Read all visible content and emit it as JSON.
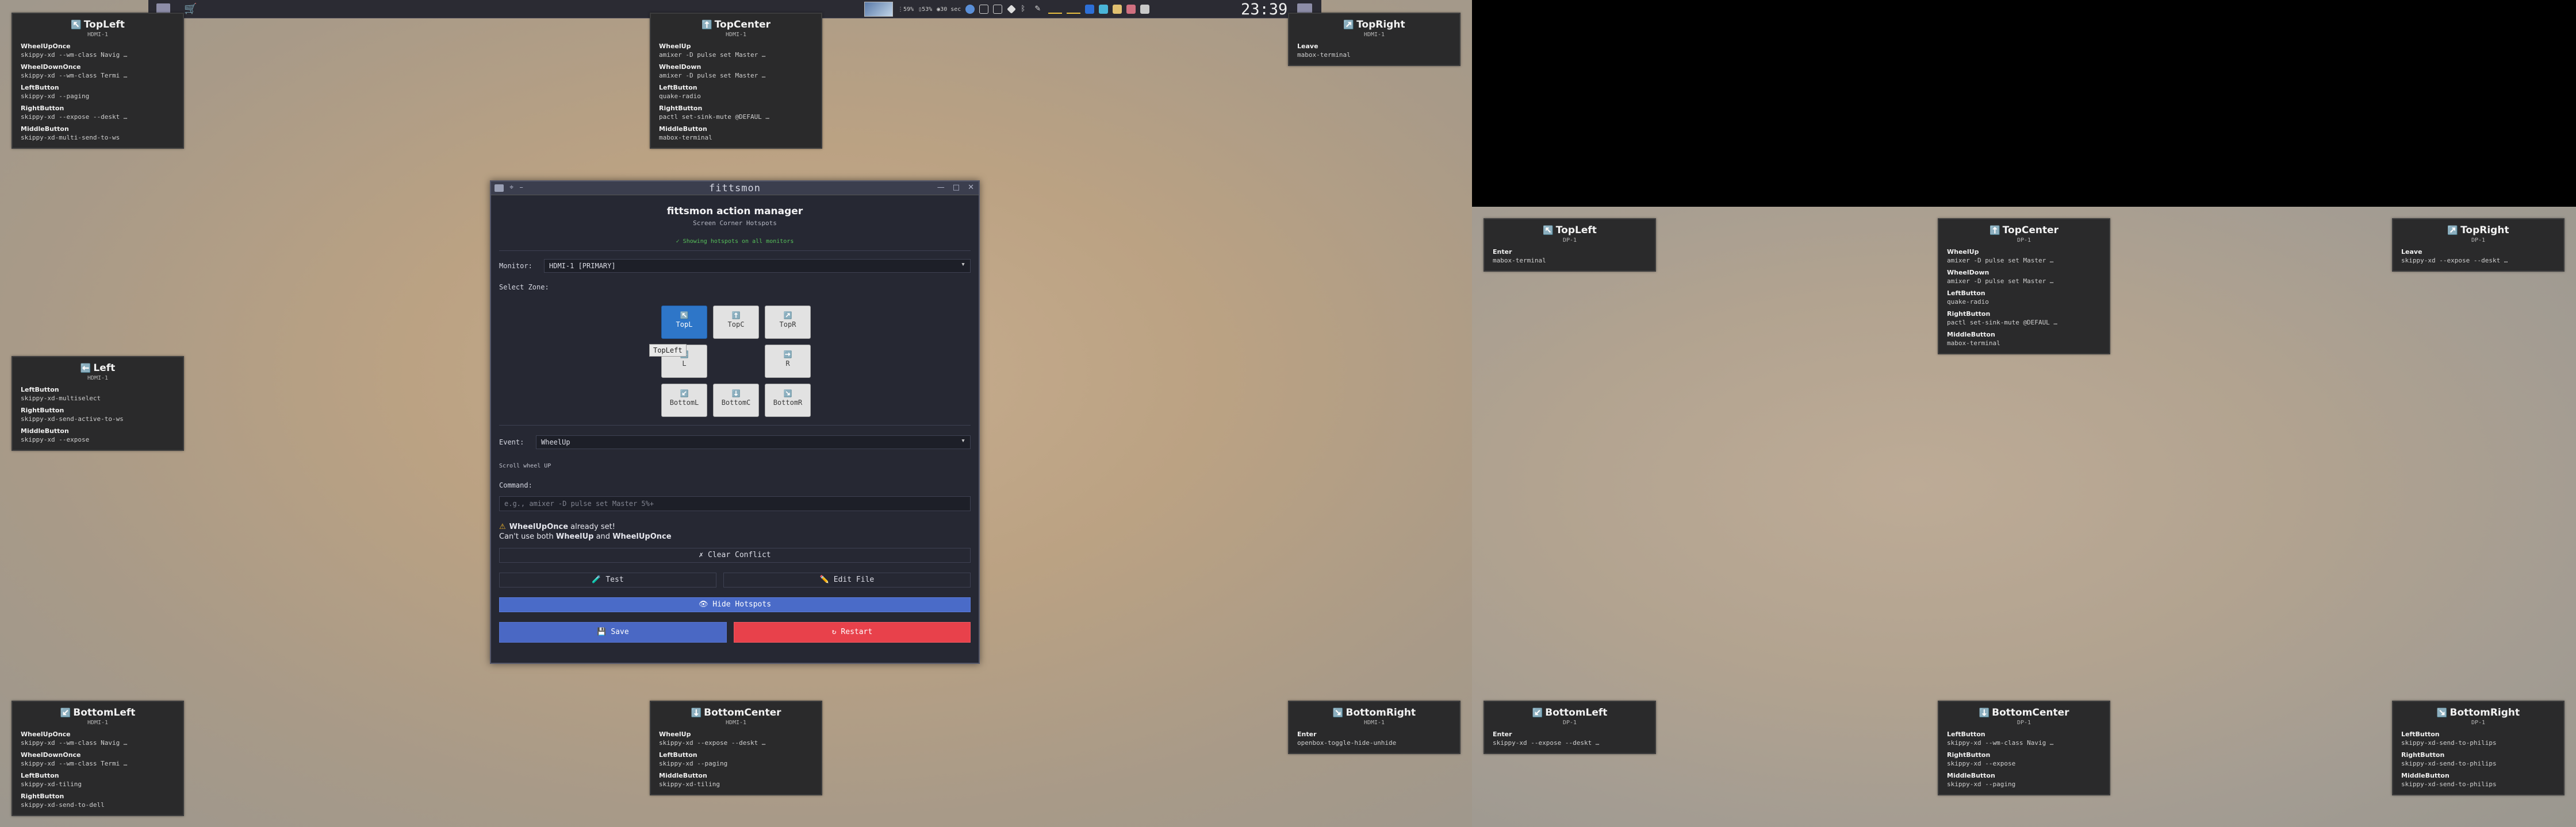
{
  "topbar": {
    "tray_text_1": "59%",
    "tray_text_2": "53%",
    "tray_text_3": "30 sec",
    "clock": "23:39"
  },
  "cards": {
    "hdmi_topleft": {
      "icon": "↖️",
      "title": "TopLeft",
      "monitor": "HDMI-1",
      "entries": [
        {
          "event": "WheelUpOnce",
          "cmd": "skippy-xd --wm-class Navig …"
        },
        {
          "event": "WheelDownOnce",
          "cmd": "skippy-xd --wm-class Termi …"
        },
        {
          "event": "LeftButton",
          "cmd": "skippy-xd --paging"
        },
        {
          "event": "RightButton",
          "cmd": "skippy-xd --expose --deskt …"
        },
        {
          "event": "MiddleButton",
          "cmd": "skippy-xd-multi-send-to-ws"
        }
      ]
    },
    "hdmi_topcenter": {
      "icon": "⬆️",
      "title": "TopCenter",
      "monitor": "HDMI-1",
      "entries": [
        {
          "event": "WheelUp",
          "cmd": "amixer -D pulse set Master …"
        },
        {
          "event": "WheelDown",
          "cmd": "amixer -D pulse set Master …"
        },
        {
          "event": "LeftButton",
          "cmd": "quake-radio"
        },
        {
          "event": "RightButton",
          "cmd": "pactl set-sink-mute @DEFAUL …"
        },
        {
          "event": "MiddleButton",
          "cmd": "mabox-terminal"
        }
      ]
    },
    "hdmi_topright": {
      "icon": "↗️",
      "title": "TopRight",
      "monitor": "HDMI-1",
      "entries": [
        {
          "event": "Leave",
          "cmd": "mabox-terminal"
        }
      ]
    },
    "hdmi_left": {
      "icon": "⬅️",
      "title": "Left",
      "monitor": "HDMI-1",
      "entries": [
        {
          "event": "LeftButton",
          "cmd": "skippy-xd-multiselect"
        },
        {
          "event": "RightButton",
          "cmd": "skippy-xd-send-active-to-ws"
        },
        {
          "event": "MiddleButton",
          "cmd": "skippy-xd --expose"
        }
      ]
    },
    "hdmi_bottomleft": {
      "icon": "↙️",
      "title": "BottomLeft",
      "monitor": "HDMI-1",
      "entries": [
        {
          "event": "WheelUpOnce",
          "cmd": "skippy-xd --wm-class Navig …"
        },
        {
          "event": "WheelDownOnce",
          "cmd": "skippy-xd --wm-class Termi …"
        },
        {
          "event": "LeftButton",
          "cmd": "skippy-xd-tiling"
        },
        {
          "event": "RightButton",
          "cmd": "skippy-xd-send-to-dell"
        }
      ]
    },
    "hdmi_bottomcenter": {
      "icon": "⬇️",
      "title": "BottomCenter",
      "monitor": "HDMI-1",
      "entries": [
        {
          "event": "WheelUp",
          "cmd": "skippy-xd --expose --deskt …"
        },
        {
          "event": "LeftButton",
          "cmd": "skippy-xd --paging"
        },
        {
          "event": "MiddleButton",
          "cmd": "skippy-xd-tiling"
        }
      ]
    },
    "hdmi_bottomright": {
      "icon": "↘️",
      "title": "BottomRight",
      "monitor": "HDMI-1",
      "entries": [
        {
          "event": "Enter",
          "cmd": "openbox-toggle-hide-unhide"
        }
      ]
    },
    "dp_topleft": {
      "icon": "↖️",
      "title": "TopLeft",
      "monitor": "DP-1",
      "entries": [
        {
          "event": "Enter",
          "cmd": "mabox-terminal"
        }
      ]
    },
    "dp_topcenter": {
      "icon": "⬆️",
      "title": "TopCenter",
      "monitor": "DP-1",
      "entries": [
        {
          "event": "WheelUp",
          "cmd": "amixer -D pulse set Master …"
        },
        {
          "event": "WheelDown",
          "cmd": "amixer -D pulse set Master …"
        },
        {
          "event": "LeftButton",
          "cmd": "quake-radio"
        },
        {
          "event": "RightButton",
          "cmd": "pactl set-sink-mute @DEFAUL …"
        },
        {
          "event": "MiddleButton",
          "cmd": "mabox-terminal"
        }
      ]
    },
    "dp_topright": {
      "icon": "↗️",
      "title": "TopRight",
      "monitor": "DP-1",
      "entries": [
        {
          "event": "Leave",
          "cmd": "skippy-xd --expose --deskt …"
        }
      ]
    },
    "dp_bottomleft": {
      "icon": "↙️",
      "title": "BottomLeft",
      "monitor": "DP-1",
      "entries": [
        {
          "event": "Enter",
          "cmd": "skippy-xd --expose --deskt …"
        }
      ]
    },
    "dp_bottomcenter": {
      "icon": "⬇️",
      "title": "BottomCenter",
      "monitor": "DP-1",
      "entries": [
        {
          "event": "LeftButton",
          "cmd": "skippy-xd --wm-class Navig …"
        },
        {
          "event": "RightButton",
          "cmd": "skippy-xd --expose"
        },
        {
          "event": "MiddleButton",
          "cmd": "skippy-xd --paging"
        }
      ]
    },
    "dp_bottomright": {
      "icon": "↘️",
      "title": "BottomRight",
      "monitor": "DP-1",
      "entries": [
        {
          "event": "LeftButton",
          "cmd": "skippy-xd-send-to-philips"
        },
        {
          "event": "RightButton",
          "cmd": "skippy-xd-send-to-philips"
        },
        {
          "event": "MiddleButton",
          "cmd": "skippy-xd-send-to-philips"
        }
      ]
    }
  },
  "dialog": {
    "window_title": "fittsmon",
    "app_title": "fittsmon action manager",
    "app_subtitle": "Screen Corner Hotspots",
    "status": "✓ Showing hotspots on all monitors",
    "monitor_label": "Monitor:",
    "monitor_value": "HDMI-1 [PRIMARY]",
    "zone_label": "Select Zone:",
    "zones": {
      "topl": {
        "icon": "↖️",
        "label": "TopL"
      },
      "topc": {
        "icon": "⬆️",
        "label": "TopC"
      },
      "topr": {
        "icon": "↗️",
        "label": "TopR"
      },
      "l": {
        "icon": "⬅️",
        "label": "L"
      },
      "r": {
        "icon": "➡️",
        "label": "R"
      },
      "bottoml": {
        "icon": "↙️",
        "label": "BottomL"
      },
      "bottomc": {
        "icon": "⬇️",
        "label": "BottomC"
      },
      "bottomr": {
        "icon": "↘️",
        "label": "BottomR"
      }
    },
    "tooltip": "TopLeft",
    "event_label": "Event:",
    "event_value": "WheelUp",
    "event_hint": "Scroll wheel UP",
    "command_label": "Command:",
    "command_placeholder": "e.g., amixer -D pulse set Master 5%+",
    "warning_line1_strong": "WheelUpOnce",
    "warning_line1_rest": " already set!",
    "warning_line2_a": "Can't use both ",
    "warning_line2_b": "WheelUp",
    "warning_line2_c": " and ",
    "warning_line2_d": "WheelUpOnce",
    "clear_conflict": "✗ Clear Conflict",
    "test": "🧪 Test",
    "edit_file": "✏️ Edit File",
    "hide_hotspots": "👁 Hide Hotspots",
    "save": "💾 Save",
    "restart": "↻ Restart"
  }
}
